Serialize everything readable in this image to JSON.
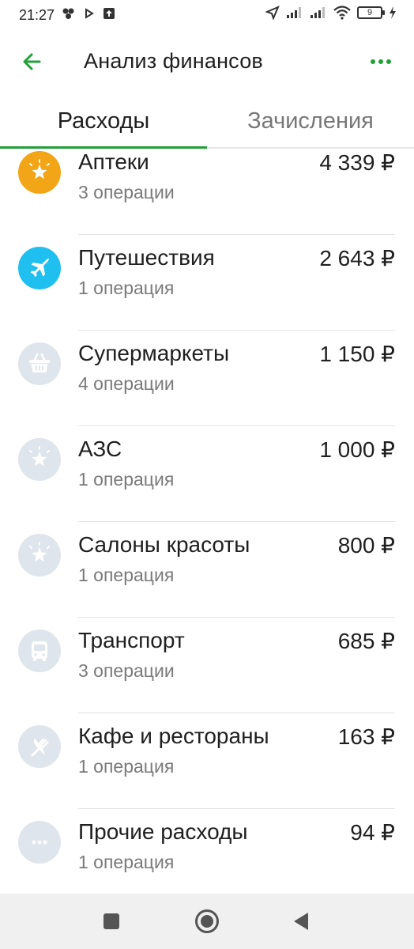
{
  "status_bar": {
    "time": "21:27",
    "battery": "9"
  },
  "app_bar": {
    "title": "Анализ финансов"
  },
  "tabs": [
    {
      "label": "Расходы"
    },
    {
      "label": "Зачисления"
    }
  ],
  "colors": {
    "accent": "#21a038",
    "pharmacy": "#f2a516",
    "travel": "#1fc0f0",
    "inactive_icon_bg": "#dfe5ec"
  },
  "categories": [
    {
      "name": "Аптеки",
      "count": "3 операции",
      "amount": "4 339 ₽",
      "icon": "star-icon"
    },
    {
      "name": "Путешествия",
      "count": "1 операция",
      "amount": "2 643 ₽",
      "icon": "airplane-icon"
    },
    {
      "name": "Супермаркеты",
      "count": "4 операции",
      "amount": "1 150 ₽",
      "icon": "basket-icon"
    },
    {
      "name": "АЗС",
      "count": "1 операция",
      "amount": "1 000 ₽",
      "icon": "star-icon"
    },
    {
      "name": "Салоны красоты",
      "count": "1 операция",
      "amount": "800 ₽",
      "icon": "star-icon"
    },
    {
      "name": "Транспорт",
      "count": "3 операции",
      "amount": "685 ₽",
      "icon": "bus-icon"
    },
    {
      "name": "Кафе и рестораны",
      "count": "1 операция",
      "amount": "163 ₽",
      "icon": "fork-knife-icon"
    },
    {
      "name": "Прочие расходы",
      "count": "1 операция",
      "amount": "94 ₽",
      "icon": "more-dots-icon"
    }
  ]
}
